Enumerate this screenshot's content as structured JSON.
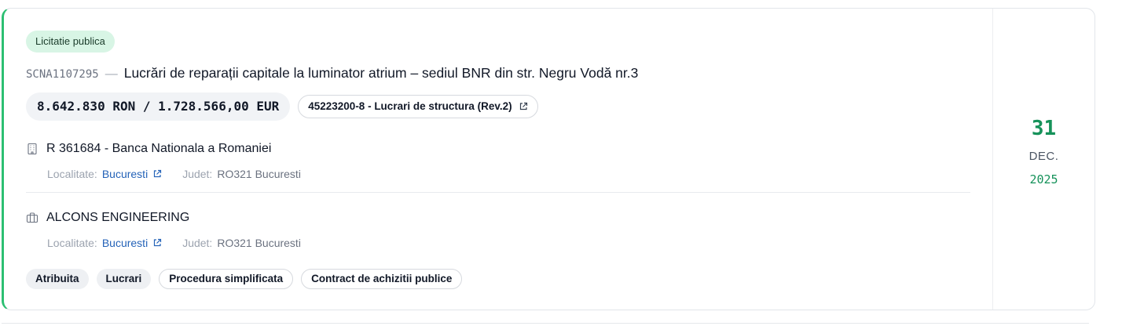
{
  "card": {
    "type_badge": "Licitatie publica",
    "code": "SCNA1107295",
    "dash": "—",
    "title": "Lucrări de reparații capitale la luminator atrium – sediul BNR din str. Negru Vodă nr.3",
    "price": "8.642.830 RON / 1.728.566,00 EUR",
    "cpv": "45223200-8 - Lucrari de structura (Rev.2)",
    "authority": {
      "name": "R 361684 - Banca Nationala a Romaniei",
      "icon": "building-icon",
      "localitate_label": "Localitate:",
      "localitate": "Bucuresti",
      "judet_label": "Judet:",
      "judet": "RO321 Bucuresti"
    },
    "winner": {
      "name": "ALCONS ENGINEERING",
      "icon": "briefcase-icon",
      "localitate_label": "Localitate:",
      "localitate": "Bucuresti",
      "judet_label": "Judet:",
      "judet": "RO321 Bucuresti"
    },
    "tags": [
      {
        "label": "Atribuita",
        "style": "filled"
      },
      {
        "label": "Lucrari",
        "style": "filled"
      },
      {
        "label": "Procedura simplificata",
        "style": "outlined"
      },
      {
        "label": "Contract de achizitii publice",
        "style": "outlined"
      }
    ],
    "date": {
      "day": "31",
      "month": "DEC.",
      "year": "2025"
    }
  },
  "colors": {
    "accent_green": "#2cbf72",
    "date_green": "#16925a",
    "link_blue": "#2563b8",
    "badge_bg": "#d8f5e5"
  }
}
